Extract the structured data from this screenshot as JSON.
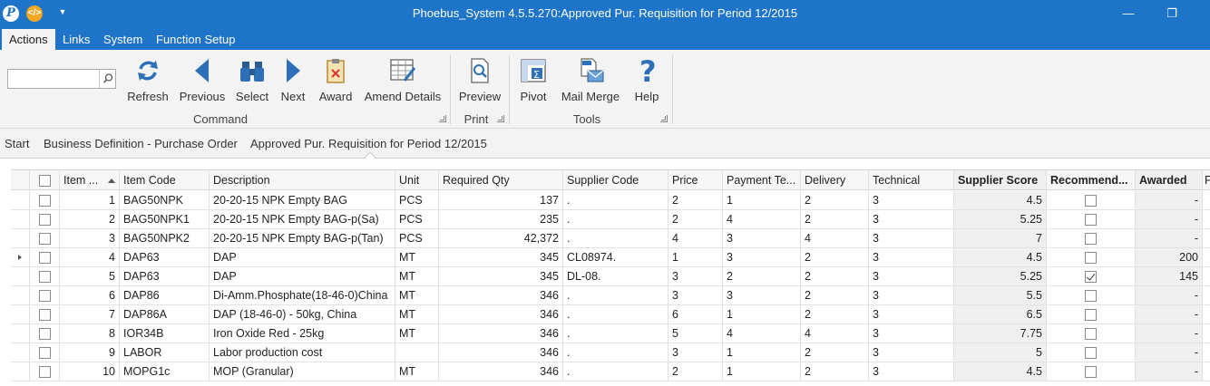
{
  "window": {
    "title": "Phoebus_System 4.5.5.270:Approved Pur. Requisition for Period 12/2015",
    "minimize_glyph": "—",
    "restore_glyph": "❐"
  },
  "menu": [
    "Actions",
    "Links",
    "System",
    "Function Setup"
  ],
  "search": {
    "value": "",
    "placeholder": ""
  },
  "ribbon": {
    "command": {
      "label": "Command",
      "buttons": [
        "Refresh",
        "Previous",
        "Select",
        "Next",
        "Award",
        "Amend Details"
      ]
    },
    "print": {
      "label": "Print",
      "buttons": [
        "Preview"
      ]
    },
    "tools": {
      "label": "Tools",
      "buttons": [
        "Pivot",
        "Mail Merge",
        "Help"
      ]
    }
  },
  "breadcrumb": [
    "Start",
    "Business Definition - Purchase Order",
    "Approved Pur. Requisition for Period 12/2015"
  ],
  "grid": {
    "headers": {
      "item_no": "Item ...",
      "item_code": "Item Code",
      "description": "Description",
      "unit": "Unit",
      "required_qty": "Required Qty",
      "supplier_code": "Supplier Code",
      "price": "Price",
      "payment_terms": "Payment Te...",
      "delivery": "Delivery",
      "technical": "Technical",
      "supplier_score": "Supplier Score",
      "recommended": "Recommend...",
      "awarded": "Awarded",
      "extra": "F"
    },
    "rows": [
      {
        "no": "1",
        "code": "BAG50NPK",
        "desc": "20-20-15 NPK Empty BAG",
        "unit": "PCS",
        "qty": "137",
        "supplier": ".",
        "price": "2",
        "pay": "1",
        "delivery": "2",
        "tech": "3",
        "score": "4.5",
        "recommended": false,
        "awarded": "-"
      },
      {
        "no": "2",
        "code": "BAG50NPK1",
        "desc": "20-20-15 NPK Empty BAG-p(Sa)",
        "unit": "PCS",
        "qty": "235",
        "supplier": ".",
        "price": "2",
        "pay": "4",
        "delivery": "2",
        "tech": "3",
        "score": "5.25",
        "recommended": false,
        "awarded": "-"
      },
      {
        "no": "3",
        "code": "BAG50NPK2",
        "desc": "20-20-15 NPK Empty BAG-p(Tan)",
        "unit": "PCS",
        "qty": "42,372",
        "supplier": ".",
        "price": "4",
        "pay": "3",
        "delivery": "4",
        "tech": "3",
        "score": "7",
        "recommended": false,
        "awarded": "-"
      },
      {
        "no": "4",
        "code": "DAP63",
        "desc": "DAP",
        "unit": "MT",
        "qty": "345",
        "supplier": "CL08974.",
        "price": "1",
        "pay": "3",
        "delivery": "2",
        "tech": "3",
        "score": "4.5",
        "recommended": false,
        "awarded": "200"
      },
      {
        "no": "5",
        "code": "DAP63",
        "desc": "DAP",
        "unit": "MT",
        "qty": "345",
        "supplier": "DL-08.",
        "price": "3",
        "pay": "2",
        "delivery": "2",
        "tech": "3",
        "score": "5.25",
        "recommended": true,
        "awarded": "145"
      },
      {
        "no": "6",
        "code": "DAP86",
        "desc": "Di-Amm.Phosphate(18-46-0)China",
        "unit": "MT",
        "qty": "346",
        "supplier": ".",
        "price": "3",
        "pay": "3",
        "delivery": "2",
        "tech": "3",
        "score": "5.5",
        "recommended": false,
        "awarded": "-"
      },
      {
        "no": "7",
        "code": "DAP86A",
        "desc": "DAP (18-46-0) - 50kg, China",
        "unit": "MT",
        "qty": "346",
        "supplier": ".",
        "price": "6",
        "pay": "1",
        "delivery": "2",
        "tech": "3",
        "score": "6.5",
        "recommended": false,
        "awarded": "-"
      },
      {
        "no": "8",
        "code": "IOR34B",
        "desc": "Iron Oxide Red - 25kg",
        "unit": "MT",
        "qty": "346",
        "supplier": ".",
        "price": "5",
        "pay": "4",
        "delivery": "4",
        "tech": "3",
        "score": "7.75",
        "recommended": false,
        "awarded": "-"
      },
      {
        "no": "9",
        "code": "LABOR",
        "desc": "Labor production cost",
        "unit": "",
        "qty": "346",
        "supplier": ".",
        "price": "3",
        "pay": "1",
        "delivery": "2",
        "tech": "3",
        "score": "5",
        "recommended": false,
        "awarded": "-"
      },
      {
        "no": "10",
        "code": "MOPG1c",
        "desc": "MOP (Granular)",
        "unit": "MT",
        "qty": "346",
        "supplier": ".",
        "price": "2",
        "pay": "1",
        "delivery": "2",
        "tech": "3",
        "score": "4.5",
        "recommended": false,
        "awarded": "-"
      }
    ],
    "current_row_index": 3
  }
}
